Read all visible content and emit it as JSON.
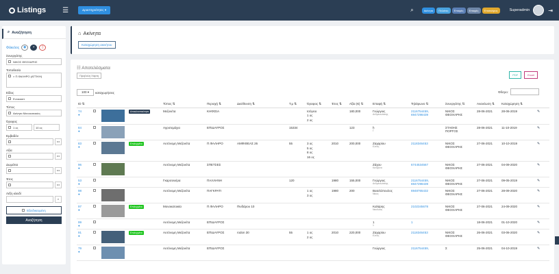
{
  "header": {
    "brand": "Listings",
    "actions_label": "Δραστηριότητες",
    "pills": [
      {
        "label": "Ακίνητα",
        "color": "#2f8fe0"
      },
      {
        "label": "Πελάτες",
        "color": "#4aa3df"
      },
      {
        "label": "Επαφές",
        "color": "#5b7fb5"
      },
      {
        "label": "Επαφές",
        "color": "#6f87a8"
      },
      {
        "label": "Επισκέψεις",
        "color": "#e0a82e"
      }
    ],
    "user": "Superadmin"
  },
  "sidebar": {
    "title": "Αναζήτηση",
    "folder_label": "Φάκελος",
    "fields": {
      "partner_label": "Συνεργάτης",
      "partner_value": "ΝΙΚΟΣ ΘΕΟΧΑΡΗΣ",
      "location_label": "Τοποθεσία",
      "location_value": "× Π.ΦΑΛΗΡΟ (ΑΤΤΙΚΗ)",
      "kind_label": "Είδος",
      "kind_value": "Ενοικιαστ",
      "type_label": "Τύπος",
      "type_value": "Ακίνητα Μονοκατοικίες",
      "floor_label": "Όροφος",
      "floor_from": "1 ος",
      "floor_to": "10 ος",
      "area_label": "Εμβαδόν",
      "price_label": "Αξία",
      "bedrooms_label": "Δωμάτια",
      "year_label": "Έτος",
      "keyword_label": "Λέξη κλειδί"
    },
    "advanced_label": "Εξειδικευμένη",
    "search_button": "Αναζήτηση"
  },
  "page": {
    "title": "Ακίνητα",
    "register_button": "Καταχώρηση ακινήτου"
  },
  "results": {
    "title": "Αποτελέσματα",
    "sub": "Προβολή Χάρτη",
    "export_pdf": "PDF",
    "export_excel": "Excel",
    "page_len": "100",
    "page_len_suffix": "καταχωρήσεις",
    "filter_label": "Φίλτρο:",
    "columns": [
      "ID",
      "",
      "",
      "",
      "Τύπος",
      "Περιοχή",
      "Διεύθυνση",
      "Τ.μ",
      "Όροφος",
      "Έτος",
      "Αξία (€)",
      "Επαφή",
      "Τηλέφωνο",
      "Συνεργάτης",
      "Ανανέωση",
      "Καταχώρηση",
      ""
    ],
    "rows": [
      {
        "id": "74",
        "tag": "Αποκλειστικότητα",
        "tag_color": "#2b3e54",
        "type": "Μεζονέτα",
        "area": "ΚΗΦΙΣΙΑ",
        "address": "",
        "sqm": "",
        "floor": [
          "Ισόγειο",
          "1 ος",
          "2 ος"
        ],
        "year": "",
        "price": "180,000",
        "contact": "Γεώργιος",
        "contact2": "Ανδρεουλάκης",
        "phones": [
          "2116754459,",
          "6947298439"
        ],
        "partner": [
          "ΝΙΚΟΣ",
          "ΘΕΟΧΑΡΗΣ"
        ],
        "renew": "28-06-2021",
        "created": "28-06-2019",
        "img": "#3d6f9b"
      },
      {
        "id": "84",
        "tag": "",
        "tag_color": "",
        "type": "Αγροτεμάχιο",
        "area": "ΕΠΙΔΑΥΡΟΣ",
        "address": "",
        "sqm": "15334",
        "floor": [],
        "year": "",
        "price": "123",
        "contact": "h",
        "contact2": "Γ",
        "phones": [],
        "partner": [
          "ΣΤΑΘΗΣ",
          "ΠΟΡΓΟΣ"
        ],
        "renew": "28-06-2021",
        "created": "11-10-2019",
        "img": "#8aa1b8"
      },
      {
        "id": "83",
        "tag": "Επιλεγμένο",
        "tag_color": "#21c521",
        "type": "Αυτόνομη Μεζονέτα",
        "area": "Π.ΦΑΛΗΡΟ",
        "address": "ΑΜΦΙΘΕΑΣ 26",
        "sqm": "55",
        "floor": [
          "3 ος",
          "5 ος",
          "8 ος",
          "16 ος"
        ],
        "year": "2010",
        "price": "200,000",
        "contact": "Ζαχαρίου",
        "contact2": "Ελενη",
        "phones": [
          "2118346453"
        ],
        "partner": [
          "ΝΙΚΟΣ",
          "ΘΕΟΧΑΡΗΣ"
        ],
        "renew": "27-06-2021",
        "created": "10-10-2019",
        "img": "#5b7893"
      },
      {
        "id": "96",
        "tag": "",
        "tag_color": "",
        "type": "Αυτόνομη Μεζονέτα",
        "area": "ΣΠΕΤΣΕΣ",
        "address": "",
        "sqm": "",
        "floor": [],
        "year": "",
        "price": "",
        "contact": "Ζάχου",
        "contact2": "Κατερίνα",
        "phones": [
          "6744534567"
        ],
        "partner": [
          "ΝΙΚΟΣ",
          "ΘΕΟΧΑΡΗΣ"
        ],
        "renew": "27-06-2021",
        "created": "04-09-2020",
        "img": "#5f7a52"
      },
      {
        "id": "53",
        "tag": "",
        "tag_color": "",
        "type": "Γκαρσονιέρα",
        "area": "ΠΑΛΛΗΝΗ",
        "address": "",
        "sqm": "120",
        "floor": [],
        "year": "1980",
        "price": "155,000",
        "contact": "Γεώργιος",
        "contact2": "Ανδρεουλάκης",
        "phones": [
          "2116754459,",
          "6947298439"
        ],
        "partner": [
          "ΝΙΚΟΣ",
          "ΘΕΟΧΑΡΗΣ"
        ],
        "renew": "27-06-2021",
        "created": "09-05-2019",
        "img": ""
      },
      {
        "id": "98",
        "tag": "",
        "tag_color": "",
        "type": "Αυτόνομη Μεζονέτα",
        "area": "ΠΑΓΚΡΑΤΙ",
        "address": "",
        "sqm": "",
        "floor": [
          "1 ος",
          "3 ος"
        ],
        "year": "1980",
        "price": "200",
        "contact": "Βασιλόπουλος",
        "contact2": "Νίκος",
        "phones": [
          "6948765432"
        ],
        "partner": [
          "ΝΙΚΟΣ",
          "ΘΕΟΧΑΡΗΣ"
        ],
        "renew": "27-06-2021",
        "created": "28-09-2020",
        "img": "#6e6e6e"
      },
      {
        "id": "97",
        "tag": "Επιλεγμένο",
        "tag_color": "#21c521",
        "type": "Μονοκατοικία",
        "area": "Π.ΦΑΛΗΡΟ",
        "address": "Πινδάρου 10",
        "sqm": "",
        "floor": [],
        "year": "",
        "price": "",
        "contact": "Καλάρης",
        "contact2": "Νικόλαος",
        "phones": [
          "2102345678"
        ],
        "partner": [
          "ΝΙΚΟΣ",
          "ΘΕΟΧΑΡΗΣ"
        ],
        "renew": "27-06-2021",
        "created": "24-09-2020",
        "img": "#9a9a9a"
      },
      {
        "id": "99",
        "tag": "",
        "tag_color": "",
        "type": "Αυτόνομη Μεζονέτα",
        "area": "ΕΠΙΔΑΥΡΟΣ",
        "address": "",
        "sqm": "",
        "floor": [],
        "year": "",
        "price": "",
        "contact": "1",
        "contact2": "1",
        "phones": [
          "1"
        ],
        "partner": [
          "",
          ""
        ],
        "renew": "18-06-2021",
        "created": "01-10-2020",
        "img": ""
      },
      {
        "id": "91",
        "tag": "Επιλεγμένο",
        "tag_color": "#21c521",
        "type": "Αυτόνομη Μεζονέτα",
        "area": "ΕΠΙΔΑΥΡΟΣ",
        "address": "rodon 30",
        "sqm": "55",
        "floor": [
          "1 ος",
          "2 ος"
        ],
        "year": "2010",
        "price": "220,000",
        "contact": "Ζαχαρίου",
        "contact2": "Ελενη",
        "phones": [
          "2118346453"
        ],
        "partner": [
          "ΝΙΚΟΣ",
          "ΘΕΟΧΑΡΗΣ"
        ],
        "renew": "26-06-2021",
        "created": "03-06-2020",
        "img": "#44607a"
      },
      {
        "id": "79",
        "tag": "",
        "tag_color": "",
        "type": "Αυτόνομη Μεζονέτα",
        "area": "ΕΠΙΔΑΥΡΟΣ",
        "address": "",
        "sqm": "",
        "floor": [],
        "year": "",
        "price": "",
        "contact": "Γεώργιος",
        "contact2": "",
        "phones": [
          "2116754459,"
        ],
        "partner": [
          "Σ",
          ""
        ],
        "renew": "25-06-2021",
        "created": "04-10-2019",
        "img": "#6d8fb0"
      }
    ]
  }
}
